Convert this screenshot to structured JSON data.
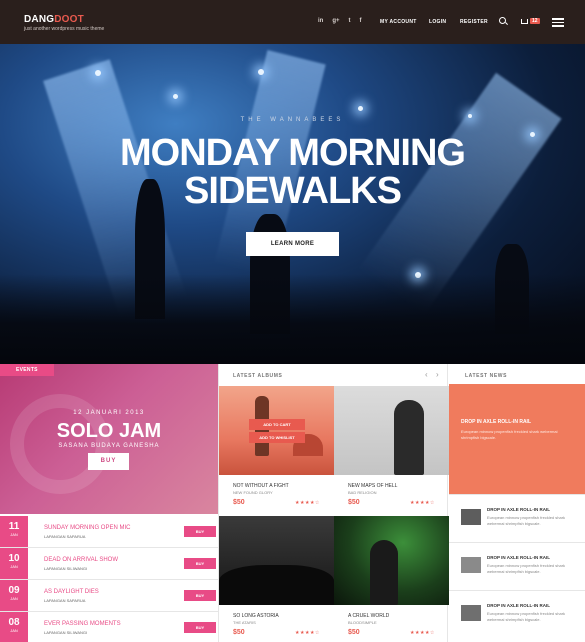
{
  "header": {
    "logo_main": "DANG",
    "logo_accent": "DOOT",
    "tagline": "just another wordpress music theme",
    "social": [
      "in",
      "g+",
      "t",
      "f"
    ],
    "nav": [
      "MY ACCOUNT",
      "LOGIN",
      "REGISTER"
    ],
    "cart_count": "12"
  },
  "hero": {
    "subtitle": "THE WANNABEES",
    "title_line1": "MONDAY MORNING",
    "title_line2": "SIDEWALKS",
    "cta": "LEARN MORE"
  },
  "events": {
    "tag": "EVENTS",
    "feature": {
      "date": "12 JANUARI 2013",
      "title": "SOLO JAM",
      "subtitle": "SASANA BUDAYA GANESHA",
      "buy": "BUY"
    },
    "list": [
      {
        "day": "11",
        "month": "JAN",
        "name": "SUNDAY MORNING OPEN MIC",
        "location": "LAPANGAN SAPARUA",
        "buy": "BUY"
      },
      {
        "day": "10",
        "month": "JAN",
        "name": "DEAD ON ARRIVAL SHOW",
        "location": "LAPANGAN SILIWANGI",
        "buy": "BUY"
      },
      {
        "day": "09",
        "month": "JAN",
        "name": "AS DAYLIGHT DIES",
        "location": "LAPANGAN SAPARUA",
        "buy": "BUY"
      },
      {
        "day": "08",
        "month": "JAN",
        "name": "EVER PASSING MOMENTS",
        "location": "LAPANGAN SILIWANGI",
        "buy": "BUY"
      }
    ]
  },
  "albums": {
    "heading": "LATEST ALBUMS",
    "add_to_cart": "ADD TO CART",
    "add_to_wishlist": "ADD TO WHISLIST",
    "items": [
      {
        "title": "NOT WITHOUT A FIGHT",
        "artist": "NEW FOUND GLORY",
        "price": "$50",
        "stars": "★★★★☆"
      },
      {
        "title": "NEW MAPS OF HELL",
        "artist": "BAD RELIGION",
        "price": "$50",
        "stars": "★★★★☆"
      },
      {
        "title": "SO LONG ASTORIA",
        "artist": "THE ATARIS",
        "price": "$50",
        "stars": "★★★★☆"
      },
      {
        "title": "A CRUEL WORLD",
        "artist": "BLOODSIMPLE",
        "price": "$50",
        "stars": "★★★★☆"
      }
    ]
  },
  "news": {
    "heading": "LATEST NEWS",
    "feature": {
      "title": "DROP IN AXLE ROLL-IN RAIL",
      "text": "European minnow propenfish freckled shark webermai shrimpfish bigscale."
    },
    "items": [
      {
        "title": "DROP IN AXLE ROLL-IN RAIL",
        "text": "European minnow propenfish freckled shark webermai shrimpfish bigscale."
      },
      {
        "title": "DROP IN AXLE ROLL-IN RAIL",
        "text": "European minnow propenfish freckled shark webermai shrimpfish bigscale."
      },
      {
        "title": "DROP IN AXLE ROLL-IN RAIL",
        "text": "European minnow propenfish freckled shark webermai shrimpfish bigscale."
      }
    ]
  }
}
